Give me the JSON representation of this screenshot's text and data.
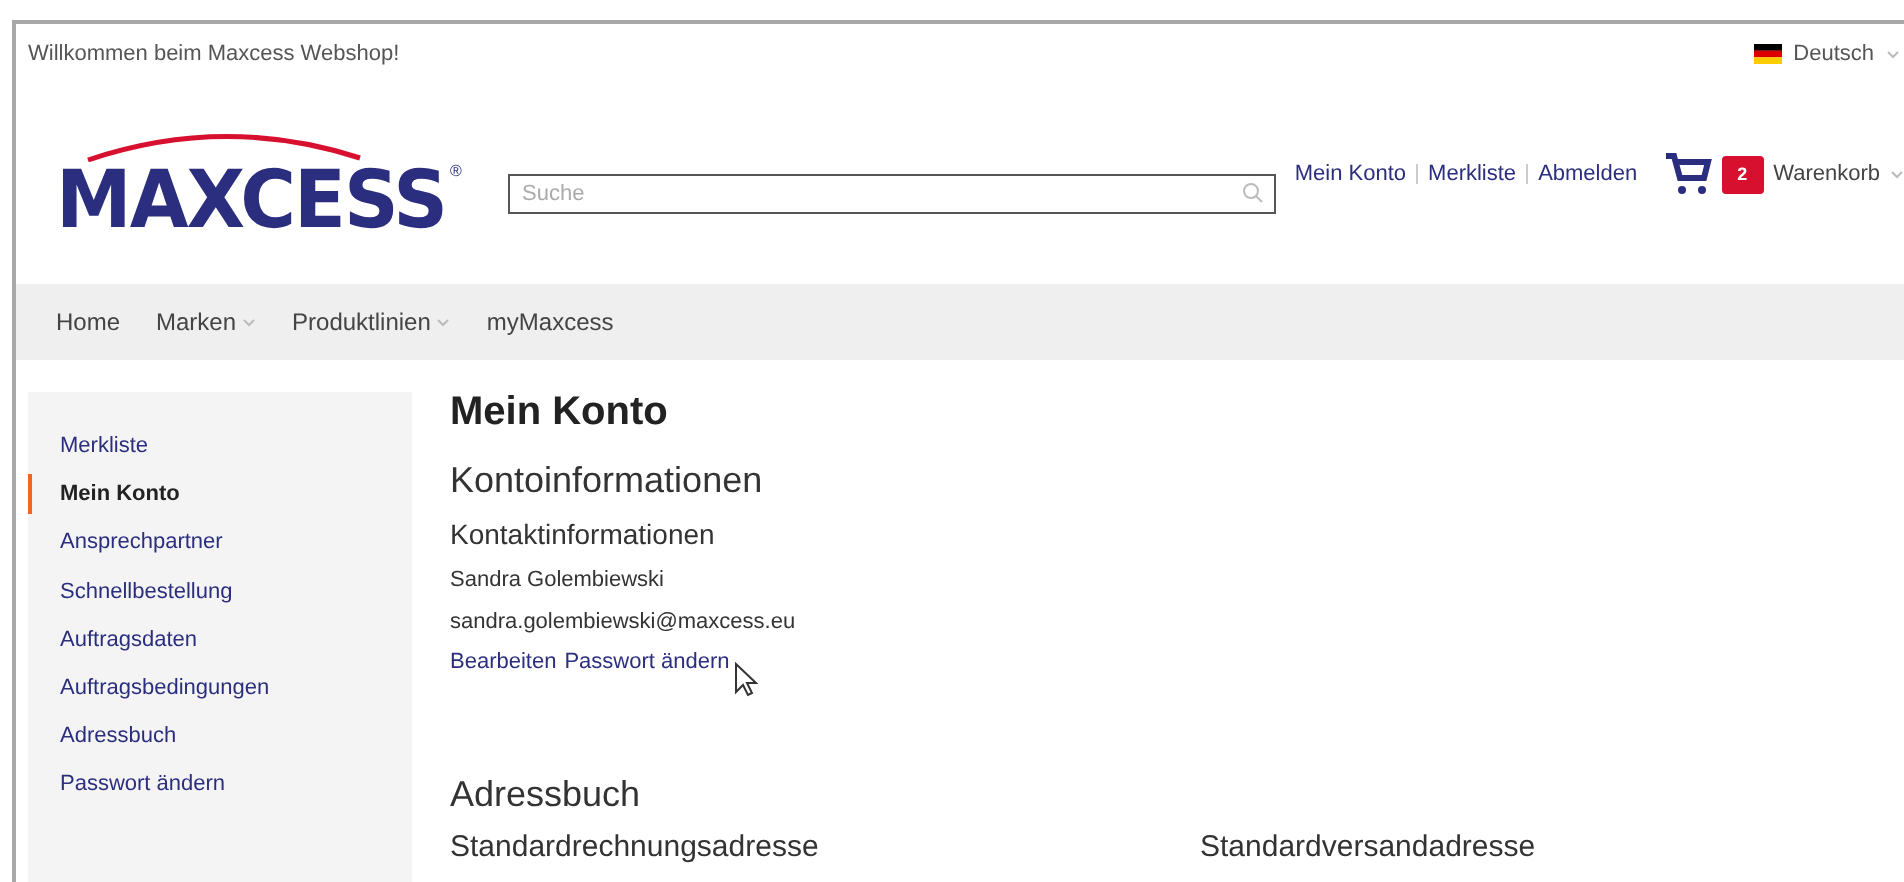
{
  "topbar": {
    "welcome": "Willkommen beim Maxcess Webshop!",
    "language": "Deutsch"
  },
  "logo": {
    "text": "MAXCESS",
    "mark": "®"
  },
  "search": {
    "placeholder": "Suche"
  },
  "account_links": [
    "Mein Konto",
    "Merkliste",
    "Abmelden"
  ],
  "cart": {
    "count": "2",
    "label": "Warenkorb"
  },
  "nav": [
    {
      "label": "Home",
      "dropdown": false
    },
    {
      "label": "Marken",
      "dropdown": true
    },
    {
      "label": "Produktlinien",
      "dropdown": true
    },
    {
      "label": "myMaxcess",
      "dropdown": false
    }
  ],
  "sidebar": {
    "items": [
      {
        "label": "Merkliste",
        "selected": false
      },
      {
        "label": "Mein Konto",
        "selected": true
      },
      {
        "label": "Ansprechpartner",
        "selected": false
      },
      {
        "label": "Schnellbestellung",
        "selected": false
      },
      {
        "label": "Auftragsdaten",
        "selected": false
      },
      {
        "label": "Auftragsbedingungen",
        "selected": false
      },
      {
        "label": "Adressbuch",
        "selected": false
      },
      {
        "label": "Passwort ändern",
        "selected": false
      }
    ]
  },
  "main": {
    "title": "Mein Konto",
    "section": "Kontoinformationen",
    "subsection": "Kontaktinformationen",
    "name": "Sandra Golembiewski",
    "email": "sandra.golembiewski@maxcess.eu",
    "links": [
      "Bearbeiten",
      "Passwort ändern"
    ],
    "address_title": "Adressbuch",
    "address_columns": [
      "Standardrechnungsadresse",
      "Standardversandadresse"
    ]
  }
}
